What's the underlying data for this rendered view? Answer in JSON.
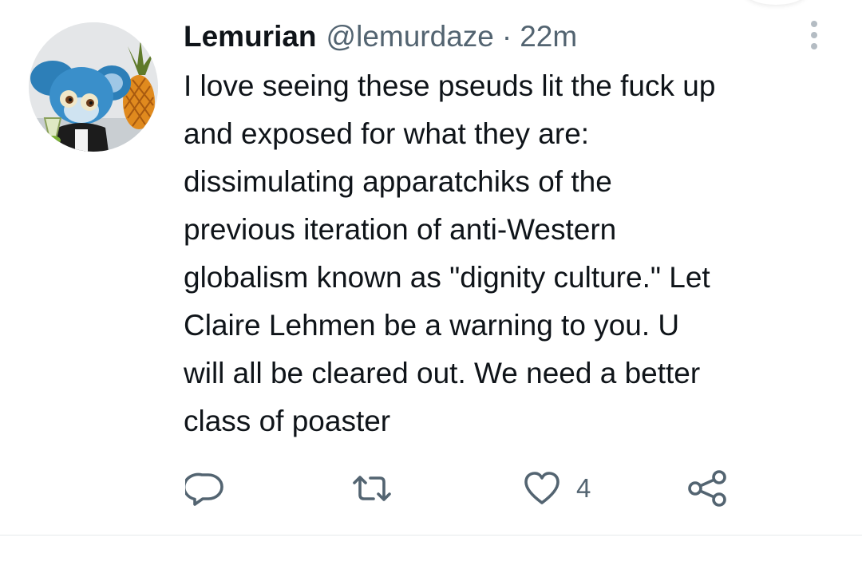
{
  "tweet": {
    "display_name": "Lemurian",
    "handle": "@lemurdaze",
    "separator": "·",
    "time": "22m",
    "body_lines": [
      "I love seeing these pseuds lit the fuck up",
      "and exposed for what they are:",
      "dissimulating apparatchiks of the",
      "previous iteration of anti-Western",
      "globalism known as \"dignity culture.\" Let",
      "Claire Lehmen be a warning to you. U",
      "will all be cleared out. We need a better",
      "class of poaster"
    ],
    "like_count": "4"
  },
  "icons": {
    "more": "more-vertical-icon",
    "reply": "reply-icon",
    "retweet": "retweet-icon",
    "like": "heart-icon",
    "share": "share-icon"
  },
  "colors": {
    "text_primary": "#0f1419",
    "text_secondary": "#536471",
    "divider": "#e6e9ec"
  }
}
